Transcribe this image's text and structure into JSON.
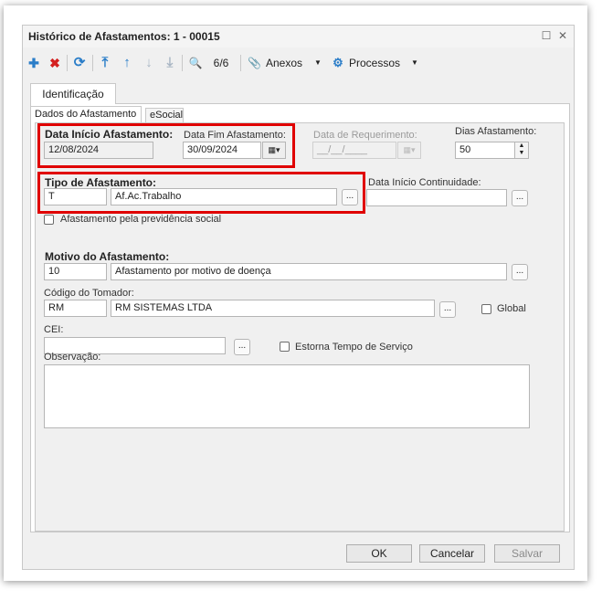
{
  "window": {
    "title": "Histórico de Afastamentos: 1 - 00015",
    "maximize_glyph": "☐",
    "close_glyph": "✕"
  },
  "toolbar": {
    "add_glyph": "✚",
    "delete_glyph": "✖",
    "refresh_glyph": "⟳",
    "first_glyph": "⤒",
    "prev_glyph": "↑",
    "next_glyph": "↓",
    "last_glyph": "⤓",
    "search_glyph": "🔍",
    "record_position": "6/6",
    "attach_glyph": "📎",
    "anexos_label": "Anexos",
    "processos_glyph": "⚙",
    "processos_label": "Processos",
    "dropdown_glyph": "▼"
  },
  "tabs": {
    "outer": "Identificação",
    "inner": [
      "Dados do Afastamento",
      "eSocial"
    ]
  },
  "form": {
    "data_inicio_label": "Data Início Afastamento:",
    "data_inicio_value": "12/08/2024",
    "data_fim_label": "Data Fim Afastamento:",
    "data_fim_value": "30/09/2024",
    "data_requerimento_label": "Data de Requerimento:",
    "data_requerimento_value": "__/__/____",
    "dias_label": "Dias Afastamento:",
    "dias_value": "50",
    "tipo_label": "Tipo de Afastamento:",
    "tipo_code": "T",
    "tipo_desc": "Af.Ac.Trabalho",
    "data_continuidade_label": "Data Início Continuidade:",
    "previdencia_label": "Afastamento pela previdência social",
    "motivo_label": "Motivo do Afastamento:",
    "motivo_code": "10",
    "motivo_desc": "Afastamento por motivo de doença",
    "tomador_label": "Código do Tomador:",
    "tomador_code": "RM",
    "tomador_desc": "RM SISTEMAS LTDA",
    "global_label": "Global",
    "cei_label": "CEI:",
    "estorna_label": "Estorna Tempo de Serviço",
    "observacao_label": "Observação:",
    "lookup_label": "...",
    "calendar_glyph": "▦▾",
    "spin_up": "▲",
    "spin_down": "▼"
  },
  "buttons": {
    "ok": "OK",
    "cancelar": "Cancelar",
    "salvar": "Salvar"
  }
}
